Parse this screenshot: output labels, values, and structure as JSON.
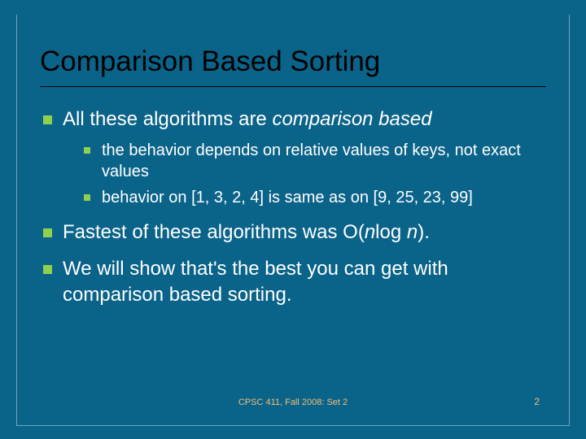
{
  "title": "Comparison Based Sorting",
  "bullets": {
    "b1": {
      "pre": "All these algorithms are ",
      "em": "comparison based",
      "sub1": "the behavior depends on relative values of keys, not exact values",
      "sub2": "behavior on [1, 3, 2, 4] is same as on [9, 25, 23, 99]"
    },
    "b2": {
      "pre": "Fastest of these algorithms was O(",
      "em1": "n",
      "mid": "log ",
      "em2": "n",
      "post": ")."
    },
    "b3": "We will show that's the best you can get with comparison based sorting."
  },
  "footer": {
    "center": "CPSC 411, Fall 2008: Set 2",
    "page": "2"
  }
}
